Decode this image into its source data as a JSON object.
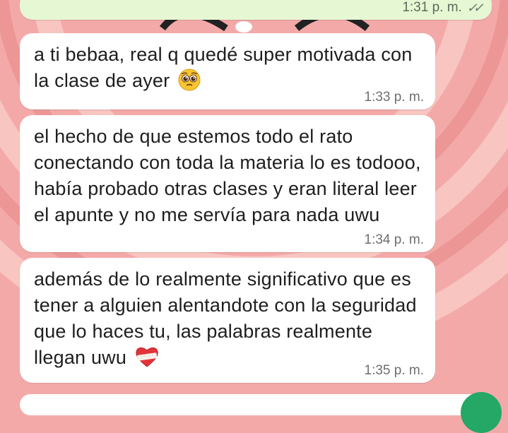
{
  "chat": {
    "sent_message": {
      "time": "1:31 p. m."
    },
    "messages": [
      {
        "text": "a ti bebaa, real q quedé super motivada con la clase de ayer",
        "time": "1:33 p. m.",
        "emoji": "pleading-face"
      },
      {
        "text": "el hecho de que estemos todo el rato conectando con toda la materia lo es todooo, había probado otras clases y eran literal leer el apunte y no me servía para nada uwu",
        "time": "1:34 p. m."
      },
      {
        "text": "además de lo realmente significativo que es tener a alguien alentandote con la seguridad que lo haces tu, las palabras realmente llegan uwu",
        "time": "1:35 p. m.",
        "emoji": "mending-heart"
      }
    ]
  },
  "colors": {
    "wallpaper": "#f4a9a9",
    "incoming_bubble": "#ffffff",
    "outgoing_bubble": "#e6f7d4",
    "fab": "#25a766"
  }
}
